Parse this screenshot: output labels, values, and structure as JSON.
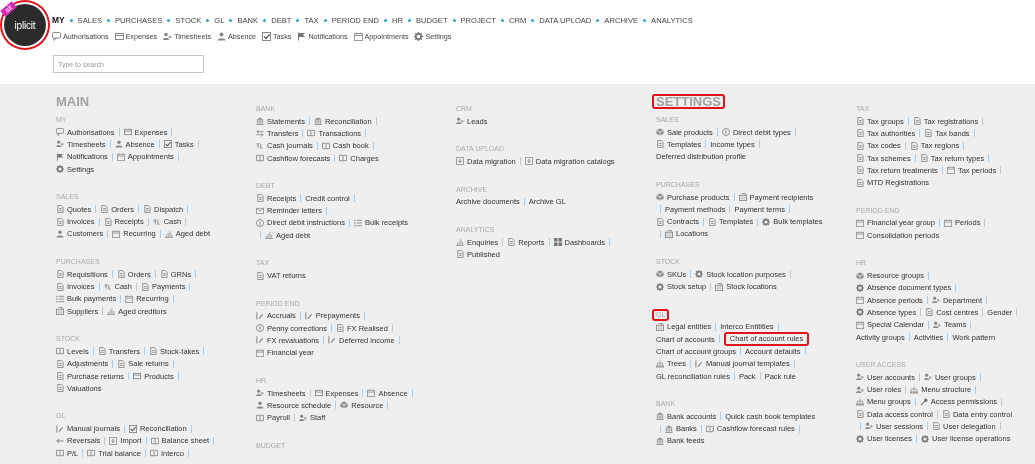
{
  "logo": {
    "text": "iplicit",
    "ribbon": "alt",
    "highlighted": true
  },
  "nav": [
    {
      "label": "MY",
      "selected": true
    },
    {
      "label": "SALES",
      "selected": false
    },
    {
      "label": "PURCHASES",
      "selected": false
    },
    {
      "label": "STOCK",
      "selected": false
    },
    {
      "label": "GL",
      "selected": false
    },
    {
      "label": "BANK",
      "selected": false
    },
    {
      "label": "DEBT",
      "selected": false
    },
    {
      "label": "TAX",
      "selected": false
    },
    {
      "label": "PERIOD END",
      "selected": false
    },
    {
      "label": "HR",
      "selected": false
    },
    {
      "label": "BUDGET",
      "selected": false
    },
    {
      "label": "PROJECT",
      "selected": false
    },
    {
      "label": "CRM",
      "selected": false
    },
    {
      "label": "DATA UPLOAD",
      "selected": false
    },
    {
      "label": "ARCHIVE",
      "selected": false
    },
    {
      "label": "ANALYTICS",
      "selected": false
    }
  ],
  "subnav": [
    {
      "label": "Authorisations",
      "kind": "chat"
    },
    {
      "label": "Expenses",
      "kind": "card"
    },
    {
      "label": "Timesheets",
      "kind": "people"
    },
    {
      "label": "Absence",
      "kind": "person"
    },
    {
      "label": "Tasks",
      "kind": "check"
    },
    {
      "label": "Notifications",
      "kind": "flag"
    },
    {
      "label": "Appointments",
      "kind": "calendar"
    },
    {
      "label": "Settings",
      "kind": "gear"
    }
  ],
  "search": {
    "placeholder": "Type to search"
  },
  "columns": [
    {
      "heading": {
        "text": "MAIN",
        "highlighted": false
      },
      "sections": [
        {
          "title": "MY",
          "highlighted": false,
          "lines": [
            {
              "lead": false,
              "trail": true,
              "items": [
                {
                  "label": "Authorisations",
                  "kind": "chat"
                },
                {
                  "label": "Expenses",
                  "kind": "card"
                }
              ]
            },
            {
              "lead": false,
              "trail": true,
              "items": [
                {
                  "label": "Timesheets",
                  "kind": "people"
                },
                {
                  "label": "Absence",
                  "kind": "person"
                },
                {
                  "label": "Tasks",
                  "kind": "check"
                }
              ]
            },
            {
              "lead": false,
              "trail": true,
              "items": [
                {
                  "label": "Notifications",
                  "kind": "flag"
                },
                {
                  "label": "Appointments",
                  "kind": "calendar"
                }
              ]
            },
            {
              "lead": false,
              "trail": false,
              "items": [
                {
                  "label": "Settings",
                  "kind": "gear"
                }
              ]
            }
          ]
        },
        {
          "title": "SALES",
          "highlighted": false,
          "lines": [
            {
              "lead": false,
              "trail": true,
              "items": [
                {
                  "label": "Quotes",
                  "kind": "doc"
                },
                {
                  "label": "Orders",
                  "kind": "doc"
                },
                {
                  "label": "Dispatch",
                  "kind": "doc"
                }
              ]
            },
            {
              "lead": false,
              "trail": true,
              "items": [
                {
                  "label": "Invoices",
                  "kind": "doc"
                },
                {
                  "label": "Receipts",
                  "kind": "doc"
                },
                {
                  "label": "Cash",
                  "kind": "cash"
                }
              ]
            },
            {
              "lead": false,
              "trail": false,
              "items": [
                {
                  "label": "Customers",
                  "kind": "person"
                },
                {
                  "label": "Recurring",
                  "kind": "calendar"
                },
                {
                  "label": "Aged debt",
                  "kind": "chart"
                }
              ]
            }
          ]
        },
        {
          "title": "PURCHASES",
          "highlighted": false,
          "lines": [
            {
              "lead": false,
              "trail": true,
              "items": [
                {
                  "label": "Requisitions",
                  "kind": "doc"
                },
                {
                  "label": "Orders",
                  "kind": "doc"
                },
                {
                  "label": "GRNs",
                  "kind": "doc"
                }
              ]
            },
            {
              "lead": false,
              "trail": true,
              "items": [
                {
                  "label": "Invoices",
                  "kind": "doc"
                },
                {
                  "label": "Cash",
                  "kind": "cash"
                },
                {
                  "label": "Payments",
                  "kind": "doc"
                }
              ]
            },
            {
              "lead": false,
              "trail": true,
              "items": [
                {
                  "label": "Bulk payments",
                  "kind": "list"
                },
                {
                  "label": "Recurring",
                  "kind": "calendar"
                }
              ]
            },
            {
              "lead": false,
              "trail": false,
              "items": [
                {
                  "label": "Suppliers",
                  "kind": "building"
                },
                {
                  "label": "Aged creditors",
                  "kind": "chart"
                }
              ]
            }
          ]
        },
        {
          "title": "STOCK",
          "highlighted": false,
          "lines": [
            {
              "lead": false,
              "trail": true,
              "items": [
                {
                  "label": "Levels",
                  "kind": "book"
                },
                {
                  "label": "Transfers",
                  "kind": "doc"
                },
                {
                  "label": "Stock-takes",
                  "kind": "doc"
                }
              ]
            },
            {
              "lead": false,
              "trail": true,
              "items": [
                {
                  "label": "Adjustments",
                  "kind": "doc"
                },
                {
                  "label": "Sale returns",
                  "kind": "doc"
                }
              ]
            },
            {
              "lead": false,
              "trail": true,
              "items": [
                {
                  "label": "Purchase returns",
                  "kind": "doc"
                },
                {
                  "label": "Products",
                  "kind": "card"
                }
              ]
            },
            {
              "lead": false,
              "trail": false,
              "items": [
                {
                  "label": "Valuations",
                  "kind": "doc"
                }
              ]
            }
          ]
        },
        {
          "title": "GL",
          "highlighted": false,
          "lines": [
            {
              "lead": false,
              "trail": true,
              "items": [
                {
                  "label": "Manual journals",
                  "kind": "edit"
                },
                {
                  "label": "Reconciliation",
                  "kind": "check"
                }
              ]
            },
            {
              "lead": false,
              "trail": true,
              "items": [
                {
                  "label": "Reversals",
                  "kind": "arrow"
                },
                {
                  "label": "Import",
                  "kind": "import"
                },
                {
                  "label": "Balance sheet",
                  "kind": "book"
                }
              ]
            },
            {
              "lead": false,
              "trail": true,
              "items": [
                {
                  "label": "P/L",
                  "kind": "book"
                },
                {
                  "label": "Trial balance",
                  "kind": "book"
                },
                {
                  "label": "Interco",
                  "kind": "book"
                }
              ]
            }
          ]
        }
      ]
    },
    {
      "sections": [
        {
          "title": "BANK",
          "highlighted": false,
          "lines": [
            {
              "lead": false,
              "trail": true,
              "items": [
                {
                  "label": "Statements",
                  "kind": "bank"
                },
                {
                  "label": "Reconciliation",
                  "kind": "bank"
                }
              ]
            },
            {
              "lead": false,
              "trail": true,
              "items": [
                {
                  "label": "Transfers",
                  "kind": "arrows"
                },
                {
                  "label": "Transactions",
                  "kind": "book"
                }
              ]
            },
            {
              "lead": false,
              "trail": true,
              "items": [
                {
                  "label": "Cash journals",
                  "kind": "cash"
                },
                {
                  "label": "Cash book",
                  "kind": "book"
                }
              ]
            },
            {
              "lead": false,
              "trail": false,
              "items": [
                {
                  "label": "Cashflow forecasts",
                  "kind": "book"
                },
                {
                  "label": "Charges",
                  "kind": "book"
                }
              ]
            }
          ]
        },
        {
          "title": "DEBT",
          "highlighted": false,
          "lines": [
            {
              "lead": false,
              "trail": true,
              "items": [
                {
                  "label": "Receipts",
                  "kind": "doc"
                },
                {
                  "label": "Credit control",
                  "kind": "plain"
                }
              ]
            },
            {
              "lead": false,
              "trail": true,
              "items": [
                {
                  "label": "Reminder letters",
                  "kind": "mail"
                }
              ]
            },
            {
              "lead": false,
              "trail": false,
              "items": [
                {
                  "label": "Direct debit instructions",
                  "kind": "coins"
                },
                {
                  "label": "Bulk receipts",
                  "kind": "list"
                }
              ]
            },
            {
              "lead": true,
              "trail": false,
              "items": [
                {
                  "label": "Aged debt",
                  "kind": "chart"
                }
              ]
            }
          ]
        },
        {
          "title": "TAX",
          "highlighted": false,
          "lines": [
            {
              "lead": false,
              "trail": false,
              "items": [
                {
                  "label": "VAT returns",
                  "kind": "doc"
                }
              ]
            }
          ]
        },
        {
          "title": "PERIOD END",
          "highlighted": false,
          "lines": [
            {
              "lead": false,
              "trail": true,
              "items": [
                {
                  "label": "Accruals",
                  "kind": "edit"
                },
                {
                  "label": "Prepayments",
                  "kind": "edit"
                }
              ]
            },
            {
              "lead": false,
              "trail": true,
              "items": [
                {
                  "label": "Penny corrections",
                  "kind": "coins"
                },
                {
                  "label": "FX Realised",
                  "kind": "doc"
                }
              ]
            },
            {
              "lead": false,
              "trail": true,
              "items": [
                {
                  "label": "FX revaluations",
                  "kind": "edit"
                },
                {
                  "label": "Deferred income",
                  "kind": "edit"
                }
              ]
            },
            {
              "lead": false,
              "trail": false,
              "items": [
                {
                  "label": "Financial year",
                  "kind": "calendar"
                }
              ]
            }
          ]
        },
        {
          "title": "HR",
          "highlighted": false,
          "lines": [
            {
              "lead": false,
              "trail": true,
              "items": [
                {
                  "label": "Timesheets",
                  "kind": "people"
                },
                {
                  "label": "Expenses",
                  "kind": "card"
                },
                {
                  "label": "Absence",
                  "kind": "calendar"
                }
              ]
            },
            {
              "lead": false,
              "trail": true,
              "items": [
                {
                  "label": "Resource schedule",
                  "kind": "person"
                },
                {
                  "label": "Resource",
                  "kind": "box"
                }
              ]
            },
            {
              "lead": false,
              "trail": false,
              "items": [
                {
                  "label": "Payroll",
                  "kind": "book"
                },
                {
                  "label": "Staff",
                  "kind": "people"
                }
              ]
            }
          ]
        },
        {
          "title": "BUDGET",
          "highlighted": false
        }
      ]
    },
    {
      "sections": [
        {
          "title": "CRM",
          "highlighted": false,
          "lines": [
            {
              "lead": false,
              "trail": false,
              "items": [
                {
                  "label": "Leads",
                  "kind": "people"
                }
              ]
            }
          ]
        },
        {
          "title": "DATA UPLOAD",
          "highlighted": false,
          "lines": [
            {
              "lead": false,
              "trail": false,
              "items": [
                {
                  "label": "Data migration",
                  "kind": "import"
                },
                {
                  "label": "Data migration catalogs",
                  "kind": "import"
                }
              ]
            }
          ]
        },
        {
          "title": "ARCHIVE",
          "highlighted": false,
          "lines": [
            {
              "lead": false,
              "trail": false,
              "items": [
                {
                  "label": "Archive documents",
                  "kind": "plain"
                },
                {
                  "label": "Archive GL",
                  "kind": "plain"
                }
              ]
            }
          ]
        },
        {
          "title": "ANALYTICS",
          "highlighted": false,
          "lines": [
            {
              "lead": false,
              "trail": true,
              "items": [
                {
                  "label": "Enquiries",
                  "kind": "chart"
                },
                {
                  "label": "Reports",
                  "kind": "doc"
                },
                {
                  "label": "Dashboards",
                  "kind": "grid"
                }
              ]
            },
            {
              "lead": false,
              "trail": false,
              "items": [
                {
                  "label": "Published",
                  "kind": "doc"
                }
              ]
            }
          ]
        }
      ]
    },
    {
      "heading": {
        "text": "SETTINGS",
        "highlighted": true
      },
      "sections": [
        {
          "title": "SALES",
          "highlighted": false,
          "lines": [
            {
              "lead": false,
              "trail": true,
              "items": [
                {
                  "label": "Sale products",
                  "kind": "box"
                },
                {
                  "label": "Direct debit types",
                  "kind": "coins"
                }
              ]
            },
            {
              "lead": false,
              "trail": true,
              "items": [
                {
                  "label": "Templates",
                  "kind": "doc"
                },
                {
                  "label": "Income types",
                  "kind": "plain"
                }
              ]
            },
            {
              "lead": false,
              "trail": false,
              "items": [
                {
                  "label": "Deferred distribution profile",
                  "kind": "plain"
                }
              ]
            }
          ]
        },
        {
          "title": "PURCHASES",
          "highlighted": false,
          "lines": [
            {
              "lead": false,
              "trail": false,
              "items": [
                {
                  "label": "Purchase products",
                  "kind": "box"
                },
                {
                  "label": "Payment recipients",
                  "kind": "building"
                }
              ]
            },
            {
              "lead": true,
              "trail": true,
              "items": [
                {
                  "label": "Payment methods",
                  "kind": "plain"
                },
                {
                  "label": "Payment terms",
                  "kind": "plain"
                }
              ]
            },
            {
              "lead": false,
              "trail": false,
              "items": [
                {
                  "label": "Contracts",
                  "kind": "doc"
                },
                {
                  "label": "Templates",
                  "kind": "doc"
                },
                {
                  "label": "Bulk templates",
                  "kind": "gear"
                }
              ]
            },
            {
              "lead": true,
              "trail": false,
              "items": [
                {
                  "label": "Locations",
                  "kind": "building"
                }
              ]
            }
          ]
        },
        {
          "title": "STOCK",
          "highlighted": false,
          "lines": [
            {
              "lead": false,
              "trail": true,
              "items": [
                {
                  "label": "SKUs",
                  "kind": "box"
                },
                {
                  "label": "Stock location purposes",
                  "kind": "gear"
                }
              ]
            },
            {
              "lead": false,
              "trail": false,
              "items": [
                {
                  "label": "Stock setup",
                  "kind": "gear"
                },
                {
                  "label": "Stock locations",
                  "kind": "building"
                }
              ]
            }
          ]
        },
        {
          "title": "GL",
          "highlighted": true,
          "lines": [
            {
              "lead": false,
              "trail": true,
              "items": [
                {
                  "label": "Legal entities",
                  "kind": "building"
                },
                {
                  "label": "Interco Entitities",
                  "kind": "plain"
                }
              ]
            },
            {
              "lead": false,
              "trail": false,
              "items": [
                {
                  "label": "Chart of accounts",
                  "kind": "plain"
                },
                {
                  "label": "Chart of account rules",
                  "kind": "plain",
                  "highlighted": true
                }
              ]
            },
            {
              "lead": false,
              "trail": true,
              "items": [
                {
                  "label": "Chart of account groups",
                  "kind": "plain"
                },
                {
                  "label": "Account defaults",
                  "kind": "plain"
                }
              ]
            },
            {
              "lead": false,
              "trail": true,
              "items": [
                {
                  "label": "Trees",
                  "kind": "tree"
                },
                {
                  "label": "Manual journal templates",
                  "kind": "edit"
                }
              ]
            },
            {
              "lead": false,
              "trail": false,
              "items": [
                {
                  "label": "GL reconciliation rules",
                  "kind": "plain"
                },
                {
                  "label": "Pack",
                  "kind": "plain"
                },
                {
                  "label": "Pack rule",
                  "kind": "plain"
                }
              ]
            }
          ]
        },
        {
          "title": "BANK",
          "highlighted": false,
          "lines": [
            {
              "lead": false,
              "trail": false,
              "items": [
                {
                  "label": "Bank accounts",
                  "kind": "bank"
                },
                {
                  "label": "Quick cash book templates",
                  "kind": "plain"
                }
              ]
            },
            {
              "lead": true,
              "trail": true,
              "items": [
                {
                  "label": "Banks",
                  "kind": "bank"
                },
                {
                  "label": "Cashflow forecast rules",
                  "kind": "book"
                }
              ]
            },
            {
              "lead": false,
              "trail": false,
              "items": [
                {
                  "label": "Bank feeds",
                  "kind": "bank"
                }
              ]
            }
          ]
        }
      ]
    },
    {
      "sections": [
        {
          "title": "TAX",
          "highlighted": false,
          "lines": [
            {
              "lead": false,
              "trail": true,
              "items": [
                {
                  "label": "Tax groups",
                  "kind": "doc"
                },
                {
                  "label": "Tax registrations",
                  "kind": "doc"
                }
              ]
            },
            {
              "lead": false,
              "trail": true,
              "items": [
                {
                  "label": "Tax authorities",
                  "kind": "doc"
                },
                {
                  "label": "Tax bands",
                  "kind": "doc"
                }
              ]
            },
            {
              "lead": false,
              "trail": true,
              "items": [
                {
                  "label": "Tax codes",
                  "kind": "doc"
                },
                {
                  "label": "Tax regions",
                  "kind": "doc"
                }
              ]
            },
            {
              "lead": false,
              "trail": true,
              "items": [
                {
                  "label": "Tax schemes",
                  "kind": "doc"
                },
                {
                  "label": "Tax return types",
                  "kind": "doc"
                }
              ]
            },
            {
              "lead": false,
              "trail": true,
              "items": [
                {
                  "label": "Tax return treatments",
                  "kind": "doc"
                },
                {
                  "label": "Tax periods",
                  "kind": "calendar"
                }
              ]
            },
            {
              "lead": false,
              "trail": false,
              "items": [
                {
                  "label": "MTD Registrations",
                  "kind": "doc"
                }
              ]
            }
          ]
        },
        {
          "title": "PERIOD END",
          "highlighted": false,
          "lines": [
            {
              "lead": false,
              "trail": true,
              "items": [
                {
                  "label": "Financial year group",
                  "kind": "calendar"
                },
                {
                  "label": "Periods",
                  "kind": "calendar"
                }
              ]
            },
            {
              "lead": false,
              "trail": false,
              "items": [
                {
                  "label": "Consolidation periods",
                  "kind": "calendar"
                }
              ]
            }
          ]
        },
        {
          "title": "HR",
          "highlighted": false,
          "lines": [
            {
              "lead": false,
              "trail": true,
              "items": [
                {
                  "label": "Resource groups",
                  "kind": "box"
                }
              ]
            },
            {
              "lead": false,
              "trail": true,
              "items": [
                {
                  "label": "Absence document types",
                  "kind": "gear"
                }
              ]
            },
            {
              "lead": false,
              "trail": true,
              "items": [
                {
                  "label": "Absence periods",
                  "kind": "calendar"
                },
                {
                  "label": "Department",
                  "kind": "people"
                }
              ]
            },
            {
              "lead": false,
              "trail": true,
              "items": [
                {
                  "label": "Absence types",
                  "kind": "gear"
                },
                {
                  "label": "Cost centres",
                  "kind": "doc"
                },
                {
                  "label": "Gender",
                  "kind": "plain"
                }
              ]
            },
            {
              "lead": false,
              "trail": true,
              "items": [
                {
                  "label": "Special Calendar",
                  "kind": "calendar"
                },
                {
                  "label": "Teams",
                  "kind": "people"
                }
              ]
            },
            {
              "lead": false,
              "trail": false,
              "items": [
                {
                  "label": "Activity groups",
                  "kind": "plain"
                },
                {
                  "label": "Activities",
                  "kind": "plain"
                },
                {
                  "label": "Work pattern",
                  "kind": "plain"
                }
              ]
            }
          ]
        },
        {
          "title": "USER ACCESS",
          "highlighted": false,
          "lines": [
            {
              "lead": false,
              "trail": true,
              "items": [
                {
                  "label": "User accounts",
                  "kind": "people"
                },
                {
                  "label": "User groups",
                  "kind": "people"
                }
              ]
            },
            {
              "lead": false,
              "trail": true,
              "items": [
                {
                  "label": "User roles",
                  "kind": "people"
                },
                {
                  "label": "Menu structure",
                  "kind": "tree"
                }
              ]
            },
            {
              "lead": false,
              "trail": true,
              "items": [
                {
                  "label": "Menu groups",
                  "kind": "tree"
                },
                {
                  "label": "Access permissions",
                  "kind": "key"
                }
              ]
            },
            {
              "lead": false,
              "trail": false,
              "items": [
                {
                  "label": "Data access control",
                  "kind": "doc"
                },
                {
                  "label": "Data entry control",
                  "kind": "doc"
                }
              ]
            },
            {
              "lead": true,
              "trail": true,
              "items": [
                {
                  "label": "User sessions",
                  "kind": "people"
                },
                {
                  "label": "User delegation",
                  "kind": "doc"
                }
              ]
            },
            {
              "lead": false,
              "trail": false,
              "items": [
                {
                  "label": "User licenses",
                  "kind": "gear"
                },
                {
                  "label": "User license operations",
                  "kind": "gear"
                }
              ]
            }
          ]
        }
      ]
    }
  ]
}
